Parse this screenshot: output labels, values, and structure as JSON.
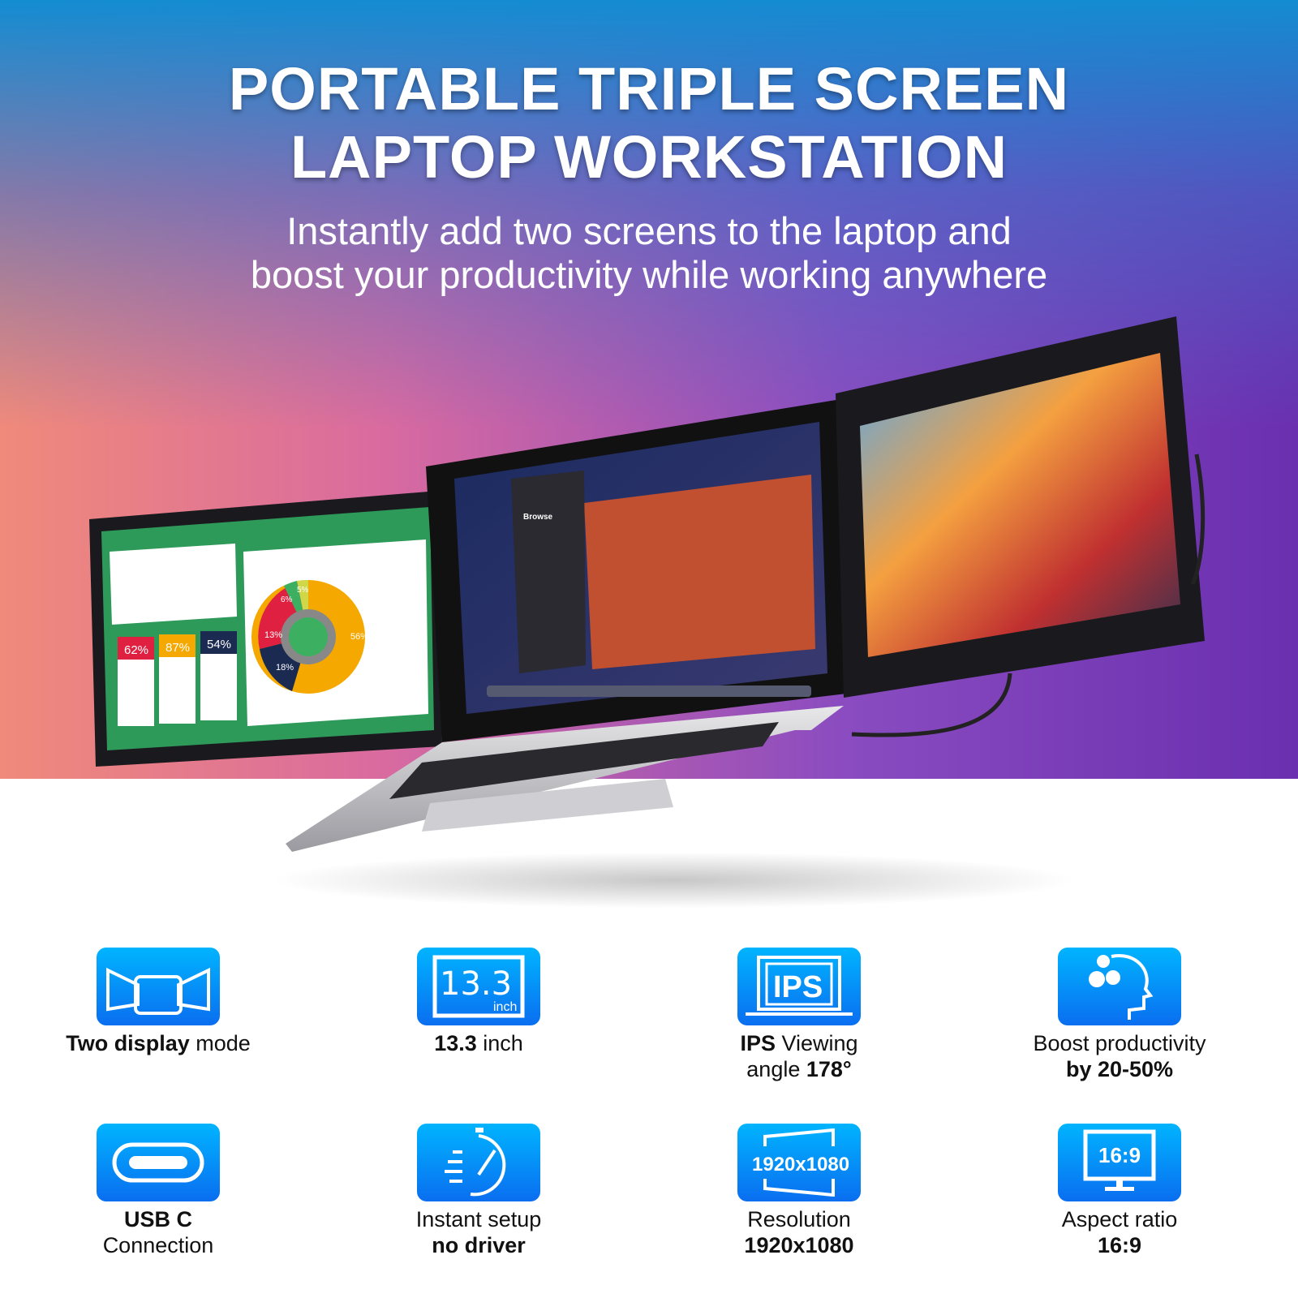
{
  "header": {
    "title_line1": "PORTABLE TRIPLE SCREEN",
    "title_line2": "LAPTOP WORKSTATION",
    "subtitle_line1": "Instantly add two screens to the laptop and",
    "subtitle_line2": "boost your productivity while working anywhere"
  },
  "screens": {
    "left_stats": [
      "62%",
      "87%",
      "54%"
    ],
    "left_donut": [
      "13%",
      "6%",
      "5%",
      "56%",
      "18%"
    ],
    "middle_heading": "Browse"
  },
  "features": [
    {
      "icon": "two-display-icon",
      "lines": [
        [
          {
            "t": "Two display",
            "b": true
          },
          {
            "t": " mode",
            "b": false
          }
        ]
      ]
    },
    {
      "icon": "screen-size-icon",
      "icon_text": "13.3",
      "icon_sub": "inch",
      "lines": [
        [
          {
            "t": "13.3",
            "b": true
          },
          {
            "t": " inch",
            "b": false
          }
        ]
      ]
    },
    {
      "icon": "ips-icon",
      "icon_text": "IPS",
      "lines": [
        [
          {
            "t": "IPS",
            "b": true
          },
          {
            "t": " Viewing",
            "b": false
          }
        ],
        [
          {
            "t": "angle ",
            "b": false
          },
          {
            "t": "178°",
            "b": true
          }
        ]
      ]
    },
    {
      "icon": "head-gears-icon",
      "lines": [
        [
          {
            "t": "Boost productivity",
            "b": false
          }
        ],
        [
          {
            "t": "by 20-50%",
            "b": true
          }
        ]
      ]
    },
    {
      "icon": "usb-c-icon",
      "lines": [
        [
          {
            "t": "USB C",
            "b": true
          }
        ],
        [
          {
            "t": "Connection",
            "b": false
          }
        ]
      ]
    },
    {
      "icon": "stopwatch-icon",
      "lines": [
        [
          {
            "t": "Instant setup",
            "b": false
          }
        ],
        [
          {
            "t": "no driver",
            "b": true
          }
        ]
      ]
    },
    {
      "icon": "resolution-icon",
      "icon_text": "1920x1080",
      "lines": [
        [
          {
            "t": "Resolution",
            "b": false
          }
        ],
        [
          {
            "t": "1920x1080",
            "b": true
          }
        ]
      ]
    },
    {
      "icon": "aspect-ratio-icon",
      "icon_text": "16:9",
      "lines": [
        [
          {
            "t": "Aspect ratio",
            "b": false
          }
        ],
        [
          {
            "t": "16:9",
            "b": true
          }
        ]
      ]
    }
  ],
  "colors": {
    "icon_top": "#00b4ff",
    "icon_bottom": "#0a6ef0"
  }
}
